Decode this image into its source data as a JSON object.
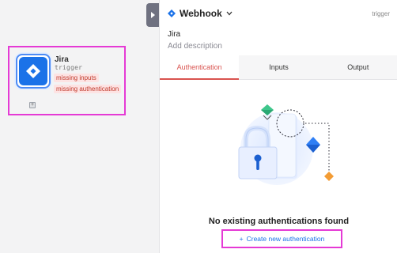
{
  "node": {
    "title": "Jira",
    "subtitle": "trigger",
    "badges": [
      "missing inputs",
      "missing authentication"
    ],
    "add_symbol": "+"
  },
  "panel": {
    "title": "Webhook",
    "tag": "trigger",
    "app_name": "Jira",
    "description_placeholder": "Add description"
  },
  "tabs": [
    {
      "label": "Authentication",
      "active": true
    },
    {
      "label": "Inputs",
      "active": false
    },
    {
      "label": "Output",
      "active": false
    }
  ],
  "empty_state": {
    "title": "No existing authentications found",
    "create_label": "Create new authentication",
    "create_icon": "+"
  },
  "colors": {
    "accent_blue": "#1b72e8",
    "active_tab_red": "#d9534f",
    "highlight_magenta": "#e53ad5",
    "error_pill_bg": "#fde3e3",
    "error_pill_text": "#c0392b"
  },
  "icons": {
    "node": "jira-diamond-icon",
    "collapse": "chevron-right-icon",
    "title_dropdown": "chevron-down-icon"
  }
}
